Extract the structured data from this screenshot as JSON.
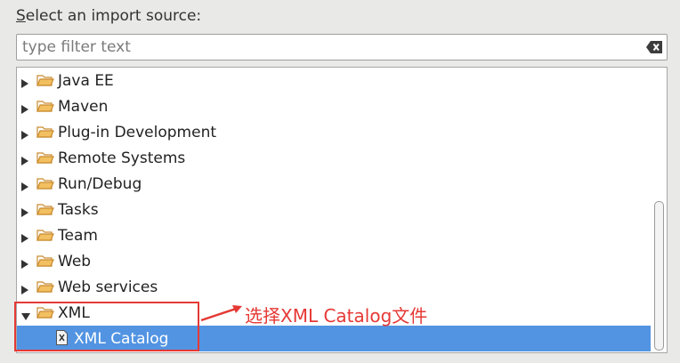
{
  "dialog": {
    "label_mnemonic": "S",
    "label_rest": "elect an import source:"
  },
  "filter": {
    "value": "",
    "placeholder": "type filter text",
    "clear_icon": "clear-text-icon"
  },
  "tree": {
    "items": [
      {
        "label": "Java EE",
        "expanded": false
      },
      {
        "label": "Maven",
        "expanded": false
      },
      {
        "label": "Plug-in Development",
        "expanded": false
      },
      {
        "label": "Remote Systems",
        "expanded": false
      },
      {
        "label": "Run/Debug",
        "expanded": false
      },
      {
        "label": "Tasks",
        "expanded": false
      },
      {
        "label": "Team",
        "expanded": false
      },
      {
        "label": "Web",
        "expanded": false
      },
      {
        "label": "Web services",
        "expanded": false
      },
      {
        "label": "XML",
        "expanded": true
      }
    ],
    "child": {
      "label": "XML Catalog",
      "selected": true
    }
  },
  "annotation": {
    "text": "选择XML Catalog文件",
    "color": "#e53935"
  },
  "colors": {
    "selection": "#5294e2",
    "folder": "#e8a94a"
  }
}
